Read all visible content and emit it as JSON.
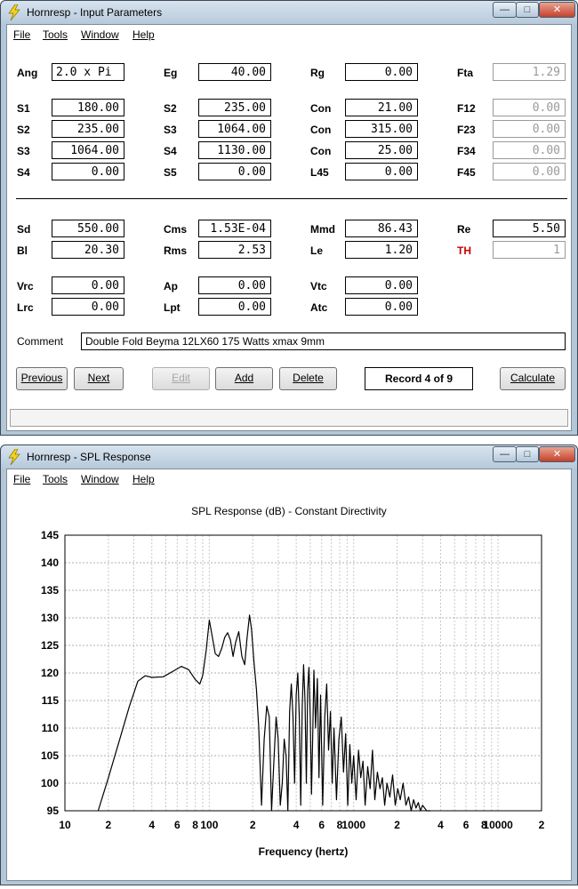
{
  "input_window": {
    "title": "Hornresp - Input Parameters",
    "menu": [
      "File",
      "Tools",
      "Window",
      "Help"
    ],
    "fields": {
      "Ang": "2.0 x Pi",
      "Eg": "40.00",
      "Rg": "0.00",
      "Fta": "1.29",
      "S1": "180.00",
      "S2a": "235.00",
      "Con1": "21.00",
      "F12": "0.00",
      "S2": "235.00",
      "S3a": "1064.00",
      "Con2": "315.00",
      "F23": "0.00",
      "S3": "1064.00",
      "S4a": "1130.00",
      "Con3": "25.00",
      "F34": "0.00",
      "S4": "0.00",
      "S5": "0.00",
      "L45": "0.00",
      "F45": "0.00",
      "Sd": "550.00",
      "Cms": "1.53E-04",
      "Mmd": "86.43",
      "Re": "5.50",
      "Bl": "20.30",
      "Rms": "2.53",
      "Le": "1.20",
      "TH": "1",
      "Vrc": "0.00",
      "Ap": "0.00",
      "Vtc": "0.00",
      "Lrc": "0.00",
      "Lpt": "0.00",
      "Atc": "0.00"
    },
    "labels": {
      "Ang": "Ang",
      "Eg": "Eg",
      "Rg": "Rg",
      "Fta": "Fta",
      "S1": "S1",
      "S2a": "S2",
      "Con1": "Con",
      "F12": "F12",
      "S2": "S2",
      "S3a": "S3",
      "Con2": "Con",
      "F23": "F23",
      "S3": "S3",
      "S4a": "S4",
      "Con3": "Con",
      "F34": "F34",
      "S4": "S4",
      "S5": "S5",
      "L45": "L45",
      "F45": "F45",
      "Sd": "Sd",
      "Cms": "Cms",
      "Mmd": "Mmd",
      "Re": "Re",
      "Bl": "Bl",
      "Rms": "Rms",
      "Le": "Le",
      "TH": "TH",
      "Vrc": "Vrc",
      "Ap": "Ap",
      "Vtc": "Vtc",
      "Lrc": "Lrc",
      "Lpt": "Lpt",
      "Atc": "Atc"
    },
    "comment_label": "Comment",
    "comment": "Double Fold Beyma 12LX60 175 Watts xmax 9mm",
    "buttons": {
      "previous": "Previous",
      "next": "Next",
      "edit": "Edit",
      "add": "Add",
      "delete": "Delete",
      "calculate": "Calculate"
    },
    "record": "Record 4 of 9"
  },
  "spl_window": {
    "title": "Hornresp - SPL Response",
    "menu": [
      "File",
      "Tools",
      "Window",
      "Help"
    ]
  },
  "chart_data": {
    "type": "line",
    "title": "SPL Response (dB) - Constant Directivity",
    "xlabel": "Frequency (hertz)",
    "ylabel": "",
    "x_scale": "log",
    "xlim": [
      10,
      20000
    ],
    "ylim": [
      95,
      145
    ],
    "y_ticks": [
      "145",
      "140",
      "135",
      "130",
      "125",
      "120",
      "115",
      "110",
      "105",
      "100",
      "95"
    ],
    "x_ticks": [
      "10",
      "2",
      "4",
      "6",
      "8",
      "100",
      "2",
      "4",
      "6",
      "8",
      "1000",
      "2",
      "4",
      "6",
      "8",
      "10000",
      "2"
    ],
    "x_tick_values": [
      10,
      20,
      40,
      60,
      80,
      100,
      200,
      400,
      600,
      800,
      1000,
      2000,
      4000,
      6000,
      8000,
      10000,
      20000
    ],
    "grid": true,
    "series": [
      {
        "color": "#000000",
        "x": [
          17,
          20,
          24,
          28,
          32,
          36,
          40,
          48,
          56,
          64,
          72,
          80,
          86,
          90,
          95,
          100,
          105,
          110,
          116,
          122,
          128,
          134,
          140,
          146,
          152,
          160,
          168,
          176,
          182,
          190,
          196,
          204,
          212,
          220,
          230,
          240,
          250,
          260,
          270,
          280,
          290,
          300,
          310,
          320,
          330,
          340,
          350,
          360,
          370,
          380,
          390,
          400,
          410,
          420,
          430,
          440,
          450,
          460,
          470,
          480,
          490,
          500,
          510,
          520,
          530,
          545,
          560,
          575,
          590,
          610,
          630,
          650,
          670,
          690,
          710,
          730,
          760,
          790,
          820,
          850,
          880,
          910,
          940,
          970,
          1000,
          1040,
          1080,
          1120,
          1160,
          1200,
          1250,
          1300,
          1350,
          1400,
          1460,
          1520,
          1580,
          1640,
          1700,
          1780,
          1860,
          1940,
          2020,
          2100,
          2200,
          2300,
          2400,
          2500,
          2600,
          2700,
          2800,
          2900,
          3000,
          3200,
          3400
        ],
        "values": [
          95,
          101,
          108,
          114,
          118.5,
          119.5,
          119.2,
          119.3,
          120.3,
          121.2,
          120.6,
          118.8,
          118,
          119.5,
          124,
          129.6,
          126.5,
          123.5,
          123,
          124.5,
          126.5,
          127.3,
          126,
          123,
          125.5,
          127.5,
          123,
          121.5,
          126,
          130.5,
          128,
          122,
          117,
          110,
          96,
          108,
          114,
          112,
          95,
          104,
          112,
          108,
          96,
          100,
          108,
          105,
          95,
          113,
          118,
          112,
          100,
          116,
          120,
          112,
          96,
          114,
          121.5,
          115,
          100,
          117,
          121,
          112,
          98,
          108,
          120.5,
          110,
          119,
          101,
          116,
          96,
          112,
          118,
          106,
          113,
          100,
          110,
          97,
          108,
          112,
          102,
          109,
          96,
          107,
          100,
          105,
          97,
          106,
          101,
          104,
          96,
          103,
          99,
          106,
          97,
          102,
          99,
          101,
          96,
          100,
          97.5,
          101.5,
          96,
          99,
          97,
          100,
          96,
          97.5,
          95,
          97,
          95.5,
          96.5,
          95,
          96,
          95,
          95
        ]
      }
    ]
  }
}
